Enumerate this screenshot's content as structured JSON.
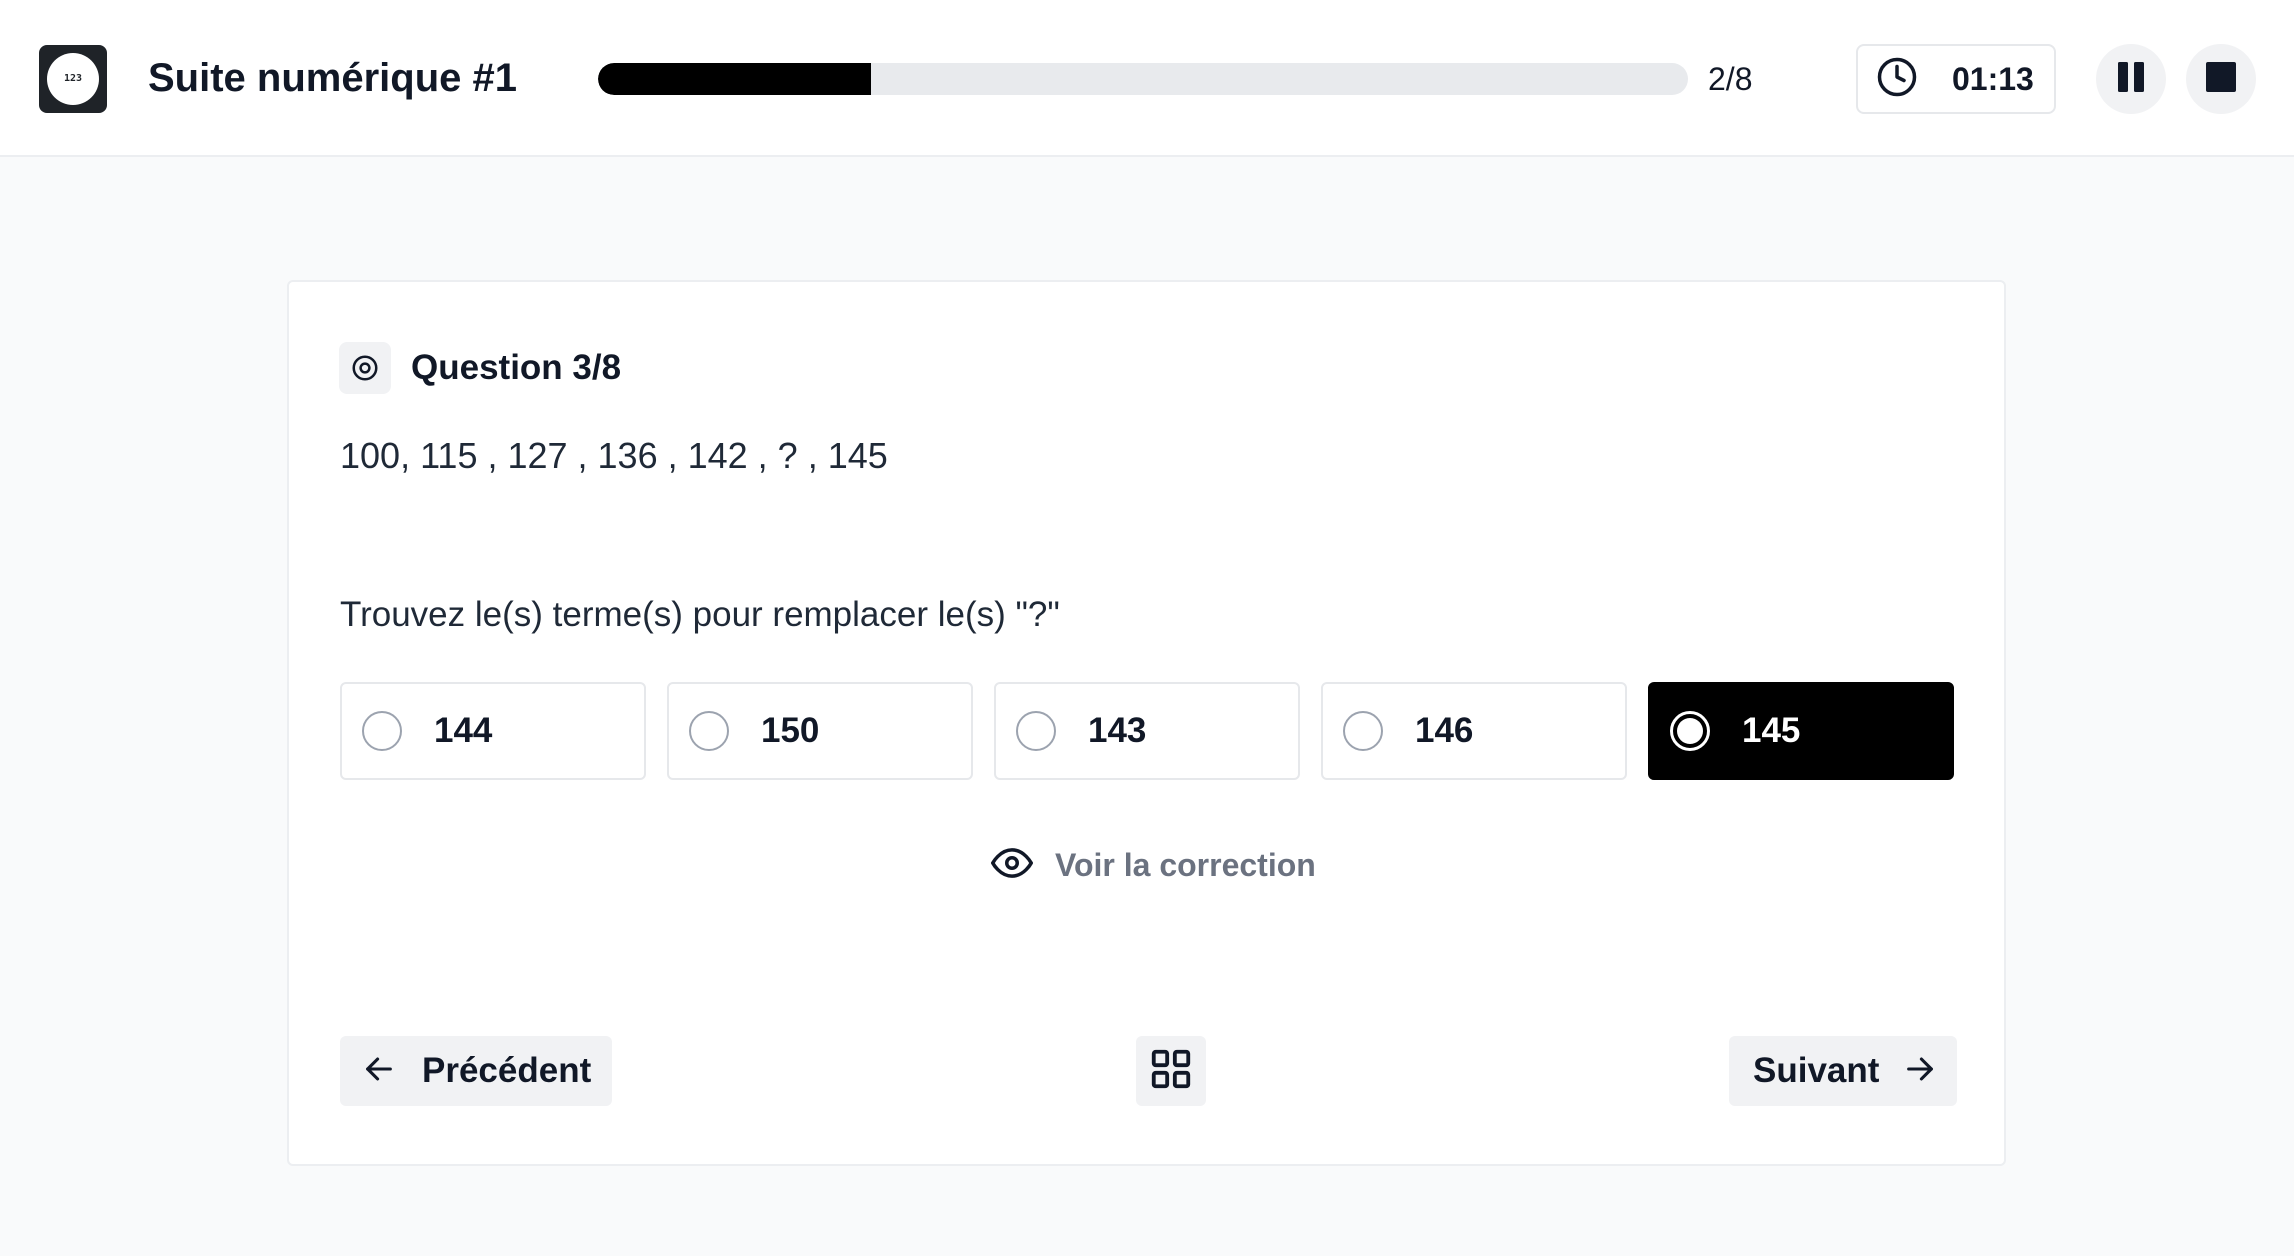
{
  "header": {
    "logo_icon": "numbers-logo-icon",
    "title": "Suite numérique #1",
    "progress": {
      "fraction": 0.25,
      "label": "2/8"
    },
    "timer": {
      "icon": "clock-icon",
      "value": "01:13"
    },
    "pause_icon": "pause-icon",
    "stop_icon": "stop-icon"
  },
  "question": {
    "icon": "target-icon",
    "label": "Question 3/8",
    "sequence": "100, 115 , 127 , 136 , 142 , ? , 145",
    "instruction": "Trouvez le(s) terme(s) pour remplacer le(s) \"?\"",
    "options": [
      {
        "label": "144",
        "selected": false
      },
      {
        "label": "150",
        "selected": false
      },
      {
        "label": "143",
        "selected": false
      },
      {
        "label": "146",
        "selected": false
      },
      {
        "label": "145",
        "selected": true
      }
    ],
    "correction": {
      "icon": "eye-icon",
      "label": "Voir la correction"
    }
  },
  "nav": {
    "prev_label": "Précédent",
    "prev_icon": "arrow-left-icon",
    "grid_icon": "grid-icon",
    "next_label": "Suivant",
    "next_icon": "arrow-right-icon"
  },
  "colors": {
    "accent": "#000000",
    "background": "#f9fafb",
    "muted_text": "#6b7280",
    "button_bg": "#f1f2f4"
  }
}
